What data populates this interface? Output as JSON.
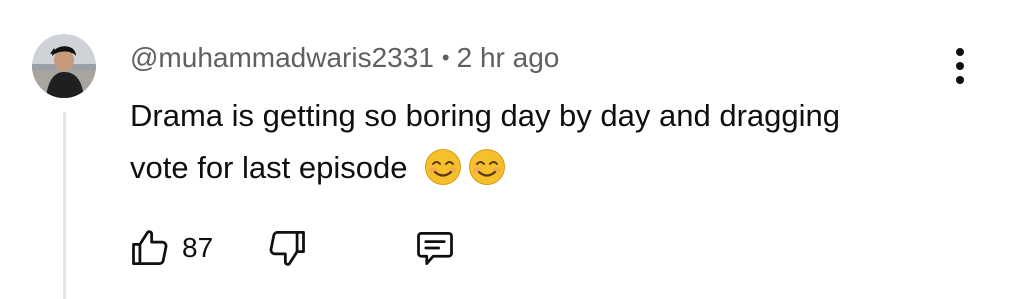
{
  "comment": {
    "author": "@muhammadwaris2331",
    "separator": "•",
    "time": "2 hr ago",
    "text": "Drama is getting so boring day by day and dragging vote for last episode",
    "emojis": [
      "smiling-face-icon",
      "smiling-face-icon"
    ]
  },
  "actions": {
    "like_count": "87",
    "like_icon": "thumbs-up-icon",
    "dislike_icon": "thumbs-down-icon",
    "reply_icon": "reply-comment-icon",
    "more_icon": "more-vertical-icon"
  },
  "colors": {
    "text": "#0f0f0f",
    "meta": "#606060",
    "thread_line": "#e5e5e5",
    "emoji_face": "#f5c02c"
  }
}
